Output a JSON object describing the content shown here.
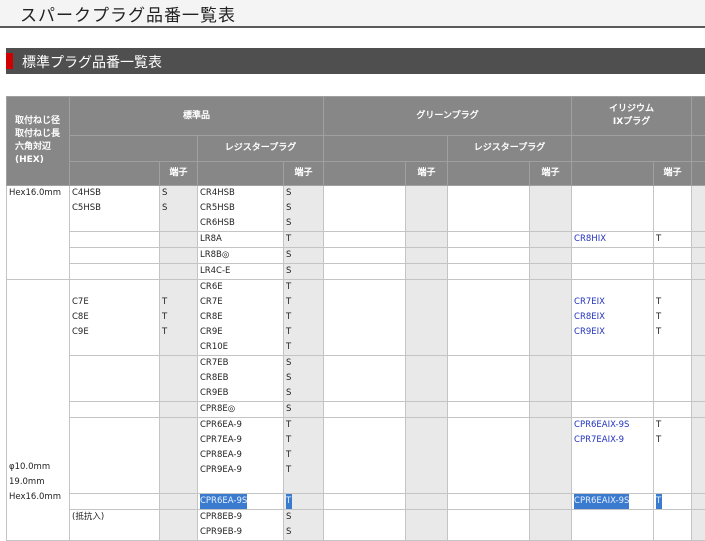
{
  "page_title": "スパークプラグ品番一覧表",
  "section_title": "標準プラグ品番一覧表",
  "header": {
    "spec_col": [
      "取付ねじ径",
      "取付ねじ長",
      "六角対辺",
      "(HEX)"
    ],
    "standard": "標準品",
    "green": "グリーンプラグ",
    "iridium": [
      "イリジウム",
      "IXプラグ"
    ],
    "resistor": "レジスタープラグ",
    "terminal": "端子"
  },
  "rows": [
    {
      "spec": [
        "Hex16.0mm"
      ],
      "std": [
        "C4HSB",
        "C5HSB"
      ],
      "std_t": [
        "S",
        "S"
      ],
      "res": [
        "CR4HSB",
        "CR5HSB",
        "CR6HSB"
      ],
      "res_t": [
        "S",
        "S",
        "S"
      ],
      "ix": [],
      "ix_t": []
    },
    {
      "spec": [],
      "std": [],
      "std_t": [],
      "res": [
        "LR8A"
      ],
      "res_t": [
        "T"
      ],
      "ix": [
        "CR8HIX"
      ],
      "ix_t": [
        "T"
      ]
    },
    {
      "spec": [],
      "std": [],
      "std_t": [],
      "res": [
        "LR8B◎"
      ],
      "res_t": [
        "S"
      ],
      "ix": [],
      "ix_t": []
    },
    {
      "spec": [],
      "std": [],
      "std_t": [],
      "res": [
        "LR4C-E"
      ],
      "res_t": [
        "S"
      ],
      "ix": [],
      "ix_t": []
    },
    {
      "spec": [],
      "std": [
        "",
        "C7E",
        "C8E",
        "C9E"
      ],
      "std_t": [
        "",
        "T",
        "T",
        "T"
      ],
      "res": [
        "CR6E",
        "CR7E",
        "CR8E",
        "CR9E",
        "CR10E"
      ],
      "res_t": [
        "T",
        "T",
        "T",
        "T",
        "T"
      ],
      "ix": [
        "",
        "CR7EIX",
        "CR8EIX",
        "CR9EIX"
      ],
      "ix_t": [
        "",
        "T",
        "T",
        "T"
      ]
    },
    {
      "spec": [],
      "std": [],
      "std_t": [],
      "res": [
        "CR7EB",
        "CR8EB",
        "CR9EB"
      ],
      "res_t": [
        "S",
        "S",
        "S"
      ],
      "ix": [],
      "ix_t": []
    },
    {
      "spec": [],
      "std": [],
      "std_t": [],
      "res": [
        "CPR8E◎"
      ],
      "res_t": [
        "S"
      ],
      "ix": [],
      "ix_t": []
    },
    {
      "spec": [
        "",
        "",
        "φ10.0mm",
        "19.0mm",
        "Hex16.0mm"
      ],
      "std": [],
      "std_t": [],
      "res": [
        "CPR6EA-9",
        "CPR7EA-9",
        "CPR8EA-9",
        "CPR9EA-9"
      ],
      "res_t": [
        "T",
        "T",
        "T",
        "T"
      ],
      "ix": [
        "CPR6EAIX-9S",
        "CPR7EAIX-9"
      ],
      "ix_t": [
        "T",
        "T"
      ]
    },
    {
      "spec": [],
      "std": [],
      "std_t": [],
      "res": [
        "CPR6EA-9S"
      ],
      "res_t": [
        "T"
      ],
      "ix": [
        "CPR6EAIX-9S"
      ],
      "ix_t": [
        "T"
      ],
      "selected": true
    },
    {
      "spec": [],
      "std": [
        "(抵抗入)"
      ],
      "std_t": [],
      "res": [
        "CPR8EB-9",
        "CPR9EB-9"
      ],
      "res_t": [
        "S",
        "S"
      ],
      "ix": [],
      "ix_t": []
    }
  ],
  "colors": {
    "header_bg": "#878787",
    "title_rule": "#5a5a5a",
    "section_bg": "#4f4f4f",
    "accent_red": "#d00000",
    "link": "#2233bb",
    "selection": "#3a7bd0"
  }
}
